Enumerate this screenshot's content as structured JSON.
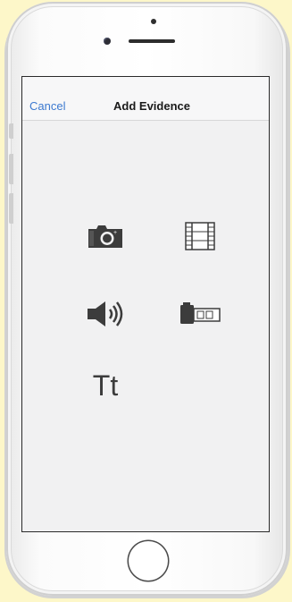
{
  "navbar": {
    "cancel_label": "Cancel",
    "title": "Add Evidence"
  },
  "evidence_options": [
    {
      "icon": "camera-icon"
    },
    {
      "icon": "film-icon"
    },
    {
      "icon": "speaker-icon"
    },
    {
      "icon": "battery-film-icon"
    },
    {
      "icon": "text-icon",
      "label": "Tt"
    }
  ],
  "colors": {
    "background": "#fdf7c9",
    "screen": "#f1f1f2",
    "accent": "#3d7ad0",
    "icon": "#3c3c3c"
  }
}
